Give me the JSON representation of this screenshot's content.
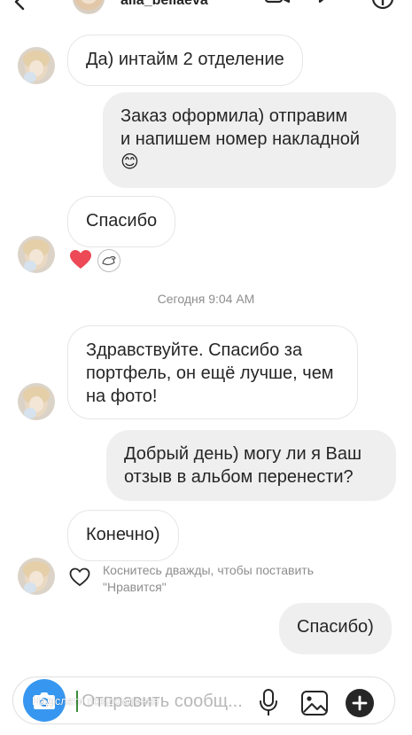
{
  "header": {
    "username": "alla_bellaeva"
  },
  "messages": [
    {
      "text": "Да) интайм 2 отделение"
    },
    {
      "text": "Заказ оформила) отправим\nи напишем номер накладной\n😊"
    },
    {
      "text": "Спасибо"
    },
    {
      "text": "Здравствуйте. Спасибо за\nпортфель, он ещё лучше, чем\nна фото!"
    },
    {
      "text": "Добрый день) могу ли я Ваш\nотзыв в альбом перенести?"
    },
    {
      "text": "Конечно)"
    },
    {
      "text": "Спасибо)"
    }
  ],
  "timestamp": "Сегодня 9:04 AM",
  "like_hint": "Коснитесь дважды, чтобы поставить\n\"Нравится\"",
  "composer": {
    "placeholder": "Отправить сообщ...",
    "overlay_label": "Надіслати повідомлення"
  },
  "icons": {
    "back": "back-arrow-icon",
    "video": "video-call-icon",
    "info": "info-icon",
    "heart_reaction": "red-heart-icon",
    "emoji_reaction": "animal-sticker-icon",
    "like": "heart-outline-icon",
    "camera": "camera-icon",
    "mic": "microphone-icon",
    "gallery": "gallery-icon",
    "plus": "plus-icon"
  },
  "colors": {
    "accent": "#3797f0",
    "heart": "#ed4956",
    "outgoing_bubble": "#efefef",
    "incoming_border": "#e6e6e6",
    "muted_text": "#8e8e8e"
  }
}
